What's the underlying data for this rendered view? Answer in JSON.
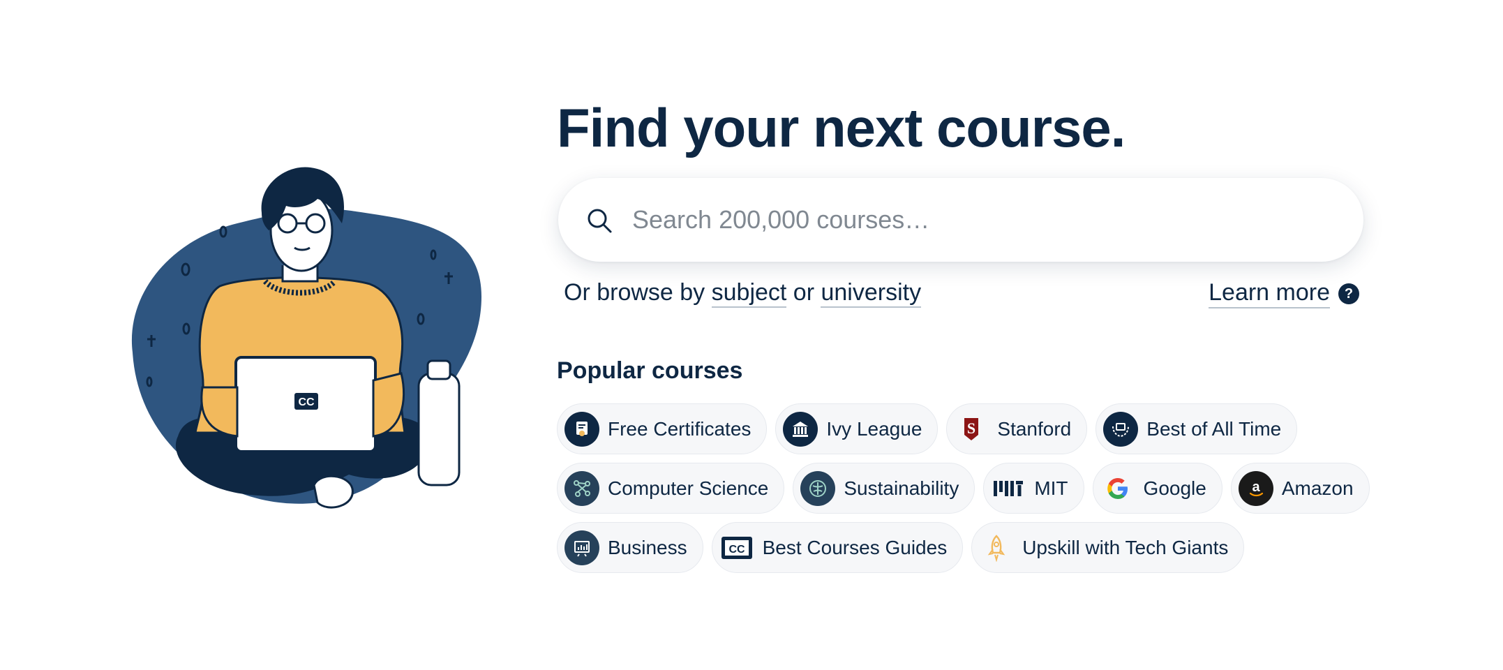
{
  "headline": "Find your next course.",
  "search": {
    "placeholder": "Search 200,000 courses…",
    "value": "",
    "icon": "search-icon"
  },
  "browse": {
    "prefix": "Or browse by ",
    "subject": "subject",
    "middle": " or ",
    "university": "university",
    "learn_more": "Learn more",
    "help_glyph": "?"
  },
  "popular": {
    "title": "Popular courses",
    "chips": [
      {
        "label": "Free Certificates",
        "icon": "certificate-icon"
      },
      {
        "label": "Ivy League",
        "icon": "university-building-icon"
      },
      {
        "label": "Stanford",
        "icon": "stanford-logo-icon"
      },
      {
        "label": "Best of All Time",
        "icon": "award-laurel-icon"
      },
      {
        "label": "Computer Science",
        "icon": "network-nodes-icon"
      },
      {
        "label": "Sustainability",
        "icon": "leaf-globe-icon"
      },
      {
        "label": "MIT",
        "icon": "mit-logo-icon"
      },
      {
        "label": "Google",
        "icon": "google-logo-icon"
      },
      {
        "label": "Amazon",
        "icon": "amazon-logo-icon"
      },
      {
        "label": "Business",
        "icon": "chart-board-icon"
      },
      {
        "label": "Best Courses Guides",
        "icon": "class-central-logo-icon"
      },
      {
        "label": "Upskill with Tech Giants",
        "icon": "rocket-icon"
      }
    ]
  },
  "illustration": {
    "laptop_logo": "CC"
  },
  "colors": {
    "navy": "#0e2743",
    "blob": "#2e5580",
    "sweater": "#f2b95c",
    "chip_bg": "#f6f7f9",
    "placeholder": "#808891",
    "google_blue": "#4285F4",
    "google_red": "#EA4335",
    "google_yellow": "#FBBC05",
    "google_green": "#34A853",
    "stanford_red": "#8c1515",
    "rocket_yellow": "#f2b95c"
  }
}
